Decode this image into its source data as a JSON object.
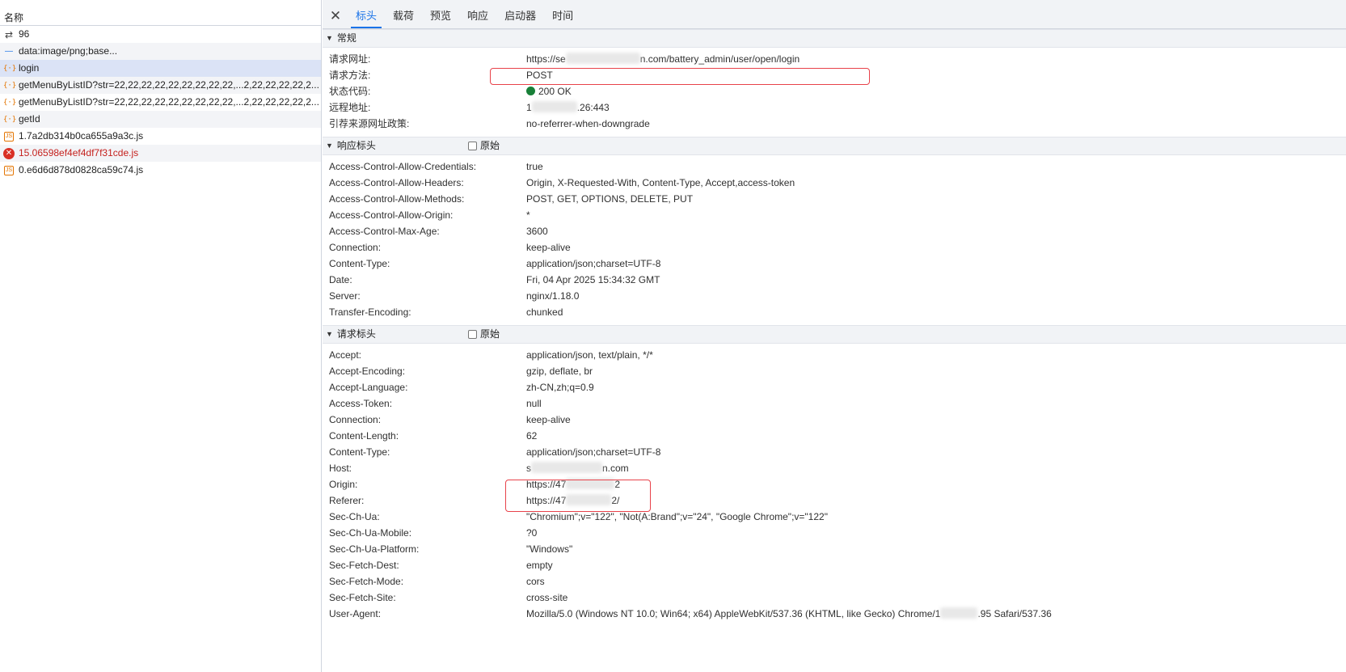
{
  "left": {
    "header": "名称",
    "requests": [
      {
        "icon": "websocket-icon",
        "glyph": "⇄",
        "label": "96",
        "state": ""
      },
      {
        "icon": "data-uri-icon",
        "glyph": "—",
        "label": "data:image/png;base...",
        "state": ""
      },
      {
        "icon": "fetch-icon",
        "glyph": "{·}",
        "label": "login",
        "state": "selected"
      },
      {
        "icon": "fetch-icon",
        "glyph": "{·}",
        "label": "getMenuByListID?str=22,22,22,22,22,22,22,22,22,...2,22,22,22,22,2...",
        "state": ""
      },
      {
        "icon": "fetch-icon",
        "glyph": "{·}",
        "label": "getMenuByListID?str=22,22,22,22,22,22,22,22,22,...2,22,22,22,22,2...",
        "state": ""
      },
      {
        "icon": "fetch-icon",
        "glyph": "{·}",
        "label": "getId",
        "state": ""
      },
      {
        "icon": "script-file-icon",
        "glyph": "JS",
        "label": "1.7a2db314b0ca655a9a3c.js",
        "state": ""
      },
      {
        "icon": "error-icon",
        "glyph": "✕",
        "label": "15.06598ef4ef4df7f31cde.js",
        "state": "error"
      },
      {
        "icon": "script-file-icon",
        "glyph": "JS",
        "label": "0.e6d6d878d0828ca59c74.js",
        "state": ""
      }
    ]
  },
  "tabs": {
    "close_glyph": "✕",
    "items": [
      "标头",
      "载荷",
      "预览",
      "响应",
      "启动器",
      "时间"
    ],
    "active": "标头"
  },
  "general": {
    "title": "常规",
    "rows": [
      {
        "k": "请求网址:",
        "v": "https://se",
        "v_tail": "n.com/battery_admin/user/open/login"
      },
      {
        "k": "请求方法:",
        "v": "POST"
      },
      {
        "k": "状态代码:",
        "v": "200 OK"
      },
      {
        "k": "远程地址:",
        "v": "1",
        "v_tail": ".26:443"
      },
      {
        "k": "引荐来源网址政策:",
        "v": "no-referrer-when-downgrade"
      }
    ]
  },
  "response_headers": {
    "title": "响应标头",
    "raw_label": "原始",
    "rows": [
      {
        "k": "Access-Control-Allow-Credentials:",
        "v": "true"
      },
      {
        "k": "Access-Control-Allow-Headers:",
        "v": "Origin, X-Requested-With, Content-Type, Accept,access-token"
      },
      {
        "k": "Access-Control-Allow-Methods:",
        "v": "POST, GET, OPTIONS, DELETE, PUT"
      },
      {
        "k": "Access-Control-Allow-Origin:",
        "v": "*"
      },
      {
        "k": "Access-Control-Max-Age:",
        "v": "3600"
      },
      {
        "k": "Connection:",
        "v": "keep-alive"
      },
      {
        "k": "Content-Type:",
        "v": "application/json;charset=UTF-8"
      },
      {
        "k": "Date:",
        "v": "Fri, 04 Apr 2025 15:34:32 GMT"
      },
      {
        "k": "Server:",
        "v": "nginx/1.18.0"
      },
      {
        "k": "Transfer-Encoding:",
        "v": "chunked"
      }
    ]
  },
  "request_headers": {
    "title": "请求标头",
    "raw_label": "原始",
    "rows": [
      {
        "k": "Accept:",
        "v": "application/json, text/plain, */*"
      },
      {
        "k": "Accept-Encoding:",
        "v": "gzip, deflate, br"
      },
      {
        "k": "Accept-Language:",
        "v": "zh-CN,zh;q=0.9"
      },
      {
        "k": "Access-Token:",
        "v": "null"
      },
      {
        "k": "Connection:",
        "v": "keep-alive"
      },
      {
        "k": "Content-Length:",
        "v": "62"
      },
      {
        "k": "Content-Type:",
        "v": "application/json;charset=UTF-8"
      },
      {
        "k": "Host:",
        "v": "s",
        "v_tail": "n.com"
      },
      {
        "k": "Origin:",
        "v": "https://47",
        "v_tail": "2"
      },
      {
        "k": "Referer:",
        "v": "https://47",
        "v_tail": "2/"
      },
      {
        "k": "Sec-Ch-Ua:",
        "v": "\"Chromium\";v=\"122\", \"Not(A:Brand\";v=\"24\", \"Google Chrome\";v=\"122\""
      },
      {
        "k": "Sec-Ch-Ua-Mobile:",
        "v": "?0"
      },
      {
        "k": "Sec-Ch-Ua-Platform:",
        "v": "\"Windows\""
      },
      {
        "k": "Sec-Fetch-Dest:",
        "v": "empty"
      },
      {
        "k": "Sec-Fetch-Mode:",
        "v": "cors"
      },
      {
        "k": "Sec-Fetch-Site:",
        "v": "cross-site"
      },
      {
        "k": "User-Agent:",
        "v": "Mozilla/5.0 (Windows NT 10.0; Win64; x64) AppleWebKit/537.36 (KHTML, like Gecko) Chrome/1",
        "v_tail": ".95 Safari/537.36"
      }
    ]
  },
  "colors": {
    "accent": "#1a73e8",
    "highlight_box": "#e8424a",
    "error": "#c5221f",
    "status_ok": "#188038"
  }
}
